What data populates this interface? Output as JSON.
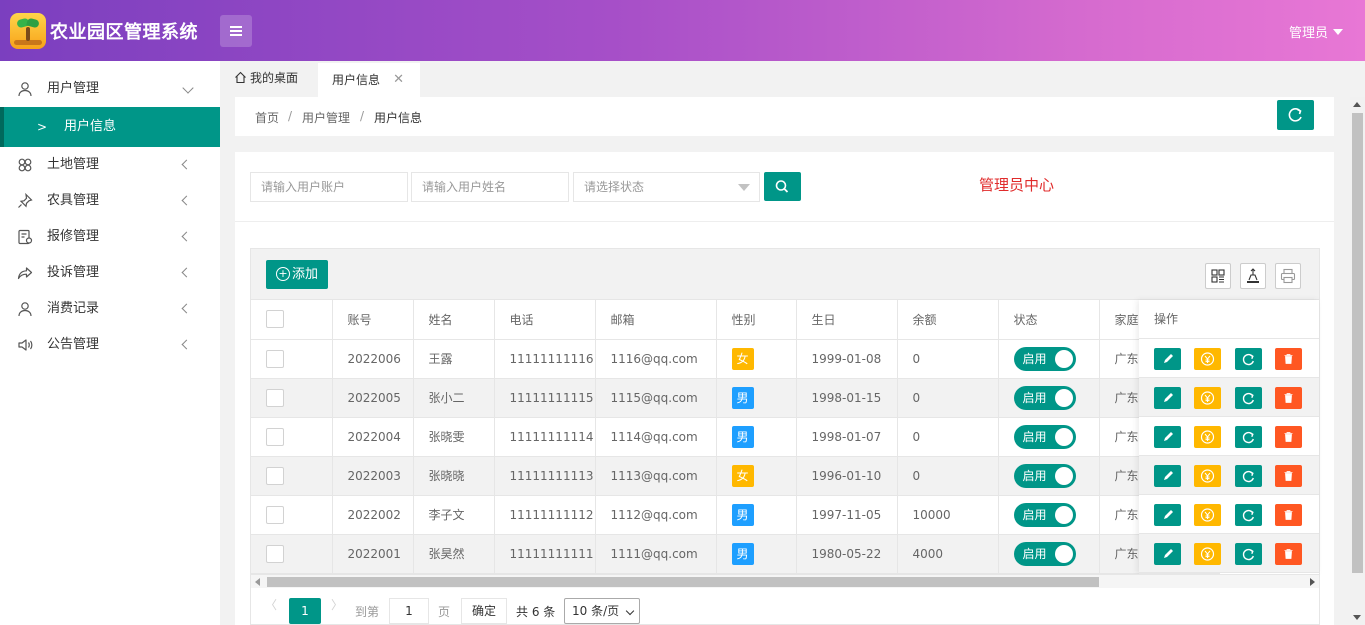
{
  "header": {
    "app_title": "农业园区管理系统",
    "user_label": "管理员"
  },
  "sidebar": {
    "items": [
      {
        "label": "用户管理",
        "icon": "user-icon",
        "expanded": true
      },
      {
        "label": "土地管理",
        "icon": "land-icon"
      },
      {
        "label": "农具管理",
        "icon": "pin-icon"
      },
      {
        "label": "报修管理",
        "icon": "repair-icon"
      },
      {
        "label": "投诉管理",
        "icon": "share-icon"
      },
      {
        "label": "消费记录",
        "icon": "user-icon"
      },
      {
        "label": "公告管理",
        "icon": "speaker-icon"
      }
    ],
    "active_sub": "用户信息"
  },
  "tabs": {
    "home": "我的桌面",
    "active": "用户信息",
    "close_glyph": "✕"
  },
  "breadcrumb": [
    "首页",
    "用户管理",
    "用户信息"
  ],
  "search": {
    "account_placeholder": "请输入用户账户",
    "name_placeholder": "请输入用户姓名",
    "status_placeholder": "请选择状态",
    "admin_center": "管理员中心"
  },
  "toolbar": {
    "add_label": "添加",
    "add_glyph": "+"
  },
  "table": {
    "columns": [
      "账号",
      "姓名",
      "电话",
      "邮箱",
      "性别",
      "生日",
      "余额",
      "状态",
      "家庭",
      "操作"
    ],
    "rows": [
      {
        "account": "2022006",
        "name": "王露",
        "phone": "11111111116",
        "email": "1116@qq.com",
        "gender": "女",
        "birthday": "1999-01-08",
        "balance": "0",
        "status": "启用",
        "home": "广东"
      },
      {
        "account": "2022005",
        "name": "张小二",
        "phone": "11111111115",
        "email": "1115@qq.com",
        "gender": "男",
        "birthday": "1998-01-15",
        "balance": "0",
        "status": "启用",
        "home": "广东"
      },
      {
        "account": "2022004",
        "name": "张晓雯",
        "phone": "11111111114",
        "email": "1114@qq.com",
        "gender": "男",
        "birthday": "1998-01-07",
        "balance": "0",
        "status": "启用",
        "home": "广东"
      },
      {
        "account": "2022003",
        "name": "张晓晓",
        "phone": "11111111113",
        "email": "1113@qq.com",
        "gender": "女",
        "birthday": "1996-01-10",
        "balance": "0",
        "status": "启用",
        "home": "广东"
      },
      {
        "account": "2022002",
        "name": "李子文",
        "phone": "11111111112",
        "email": "1112@qq.com",
        "gender": "男",
        "birthday": "1997-11-05",
        "balance": "10000",
        "status": "启用",
        "home": "广东"
      },
      {
        "account": "2022001",
        "name": "张昊然",
        "phone": "11111111111",
        "email": "1111@qq.com",
        "gender": "男",
        "birthday": "1980-05-22",
        "balance": "4000",
        "status": "启用",
        "home": "广东"
      }
    ]
  },
  "pager": {
    "prev": "〈",
    "current": "1",
    "next": "〉",
    "goto_label": "到第",
    "goto_value": "1",
    "page_label": "页",
    "confirm": "确定",
    "total": "共 6 条",
    "page_size": "10 条/页"
  },
  "colors": {
    "primary": "#009688",
    "female": "#ffb800",
    "male": "#1e9fff",
    "danger": "#ff5722",
    "admin_text": "#e02b2b"
  }
}
